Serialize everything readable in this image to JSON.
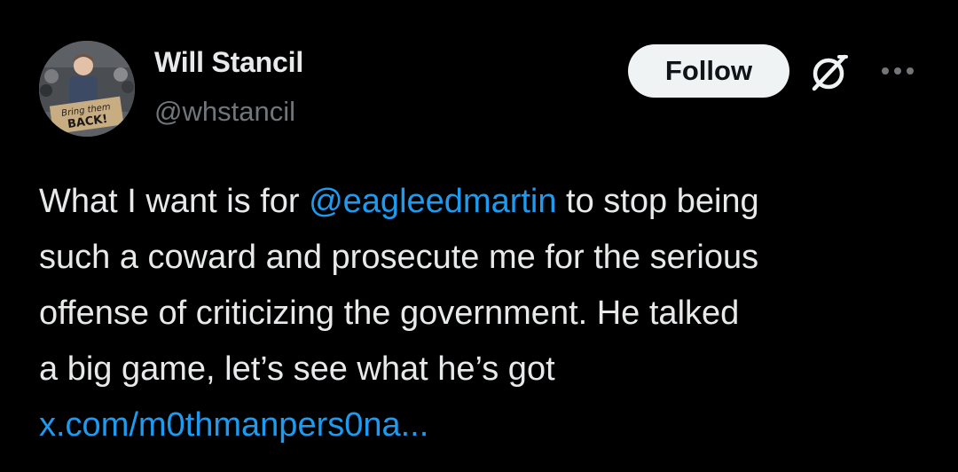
{
  "author": {
    "display_name": "Will Stancil",
    "handle": "@whstancil",
    "avatar_sign_text": [
      "Bring them",
      "BACK!"
    ]
  },
  "actions": {
    "follow_label": "Follow",
    "grok_icon": "grok-icon",
    "more_icon": "more-options-icon"
  },
  "tweet": {
    "line1_before": "What I want is for ",
    "mention": "@eagleedmartin",
    "line1_after": " to stop being",
    "line2": "such a coward and prosecute me for the serious",
    "line3": "offense of criticizing the government. He talked",
    "line4": "a big game, let’s see what he’s got",
    "link": "x.com/m0thmanpers0na..."
  },
  "colors": {
    "background": "#000000",
    "text": "#e7e9ea",
    "secondary": "#71767b",
    "accent": "#1d9bf0",
    "follow_bg": "#eff3f4"
  }
}
